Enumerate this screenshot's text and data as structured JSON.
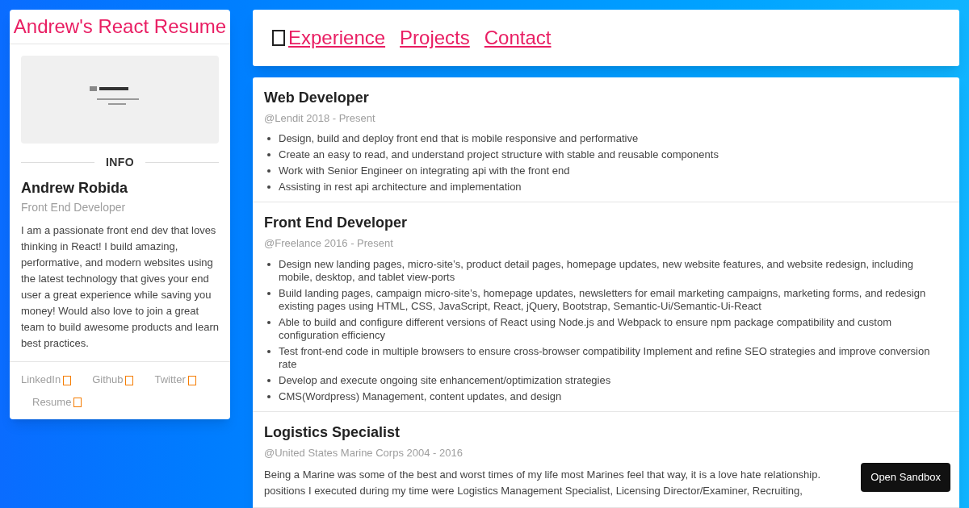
{
  "profile": {
    "site_title": "Andrew's React Resume",
    "section_label": "INFO",
    "name": "Andrew Robida",
    "role": "Front End Developer",
    "bio": "I am a passionate front end dev that loves thinking in React! I build amazing, performative, and modern websites using the latest technology that gives your end user a great experience while saving you money! Would also love to join a great team to build awesome products and learn best practices.",
    "links": [
      {
        "label": "LinkedIn"
      },
      {
        "label": "Github"
      },
      {
        "label": "Twitter"
      },
      {
        "label": "Resume"
      }
    ]
  },
  "nav": {
    "links": [
      {
        "label": "Experience"
      },
      {
        "label": "Projects"
      },
      {
        "label": "Contact"
      }
    ]
  },
  "jobs": [
    {
      "title": "Web Developer",
      "meta": "@Lendit 2018 - Present",
      "kind": "bullets",
      "items": [
        "Design, build and deploy front end that is mobile responsive and performative",
        "Create an easy to read, and understand project structure with stable and reusable components",
        "Work with Senior Engineer on integrating api with the front end",
        "Assisting in rest api architecture and implementation"
      ]
    },
    {
      "title": "Front End Developer",
      "meta": "@Freelance 2016 - Present",
      "kind": "bullets",
      "items": [
        "Design new landing pages, micro-site’s, product detail pages, homepage updates, new website features, and website redesign, including mobile, desktop, and tablet view-ports",
        "Build landing pages, campaign micro-site’s, homepage updates, newsletters for email marketing campaigns, marketing forms, and redesign existing pages using HTML, CSS, JavaScript, React, jQuery, Bootstrap, Semantic-Ui/Semantic-Ui-React",
        "Able to build and configure different versions of React using Node.js and Webpack to ensure npm package compatibility and custom configuration efficiency",
        "Test front-end code in multiple browsers to ensure cross-browser compatibility Implement and refine SEO strategies and improve conversion rate",
        "Develop and execute ongoing site enhancement/optimization strategies",
        "CMS(Wordpress) Management, content updates, and design"
      ]
    },
    {
      "title": "Logistics Specialist",
      "meta": "@United States Marine Corps 2004 - 2016",
      "kind": "paragraph",
      "items": [
        "Being a Marine was some of the best and worst times of my life most Marines feel that way, it is a love hate relationship.",
        "positions I executed during my time were Logistics Management Specialist, Licensing Director/Examiner, Recruiting,"
      ]
    }
  ],
  "sandbox_button": "Open Sandbox"
}
